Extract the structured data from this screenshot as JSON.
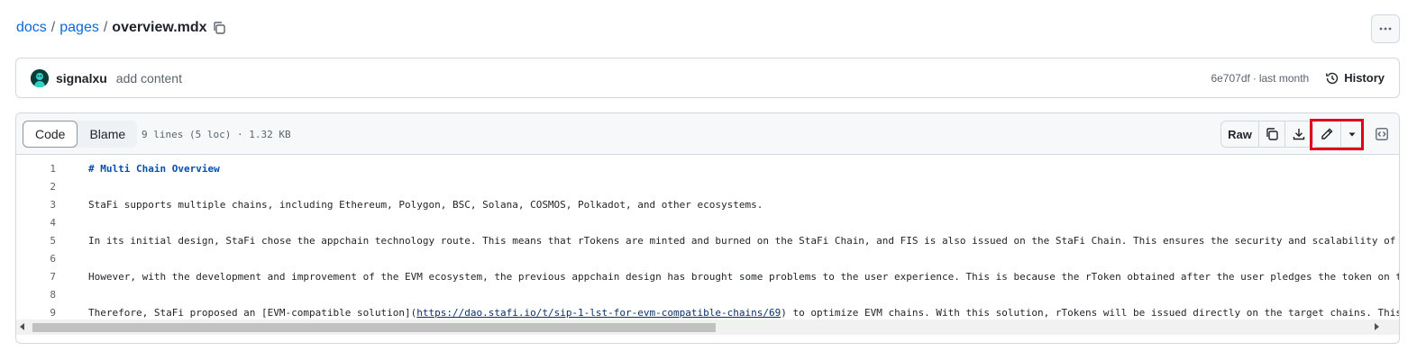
{
  "breadcrumb": {
    "items": [
      "docs",
      "pages"
    ],
    "separator": "/",
    "current": "overview.mdx"
  },
  "commit": {
    "author": "signalxu",
    "message": "add content",
    "sha": "6e707df",
    "meta_sep": "·",
    "time": "last month",
    "history_label": "History"
  },
  "file": {
    "tabs": [
      "Code",
      "Blame"
    ],
    "active_tab": "Code",
    "info": "9 lines (5 loc) · 1.32 KB",
    "raw_label": "Raw",
    "icons": {
      "copy_path": "copy-icon",
      "more": "kebab-horizontal-icon",
      "copy_raw": "copy-icon",
      "download": "download-icon",
      "edit": "pencil-icon",
      "dropdown": "triangle-down-icon",
      "symbols": "code-square-icon",
      "history": "history-icon"
    }
  },
  "code": {
    "lines": [
      {
        "n": "1",
        "text": "# Multi Chain Overview"
      },
      {
        "n": "2",
        "text": ""
      },
      {
        "n": "3",
        "text": "StaFi supports multiple chains, including Ethereum, Polygon, BSC, Solana, COSMOS, Polkadot, and other ecosystems."
      },
      {
        "n": "4",
        "text": ""
      },
      {
        "n": "5",
        "text": "In its initial design, StaFi chose the appchain technology route. This means that rTokens are minted and burned on the StaFi Chain, and FIS is also issued on the StaFi Chain. This ensures the security and scalability of ass"
      },
      {
        "n": "6",
        "text": ""
      },
      {
        "n": "7",
        "text": "However, with the development and improvement of the EVM ecosystem, the previous appchain design has brought some problems to the user experience. This is because the rToken obtained after the user pledges the token on the"
      },
      {
        "n": "8",
        "text": ""
      },
      {
        "n": "9",
        "before": "Therefore, StaFi proposed an [EVM-compatible solution](",
        "link": "https://dao.stafi.io/t/sip-1-lst-for-evm-compatible-chains/69",
        "after": ") to optimize EVM chains. With this solution, rTokens will be issued directly on the target chains. This wi"
      }
    ]
  },
  "colors": {
    "link": "#0969da",
    "highlight": "#e0001b",
    "heading": "#0550ae"
  }
}
